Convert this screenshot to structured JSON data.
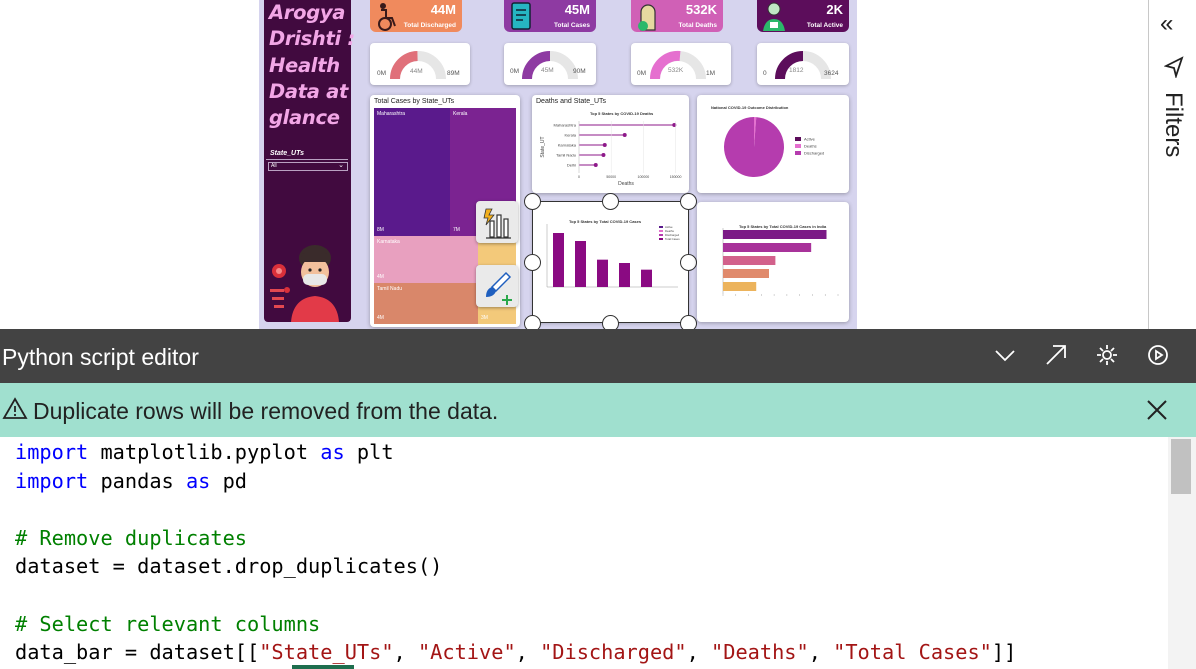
{
  "report": {
    "title_lines": [
      "Arogya",
      "Drishti :",
      "Health",
      "Data at",
      "glance"
    ],
    "slicer": {
      "label": "State_UTs",
      "value": "All"
    },
    "kpis": [
      {
        "value": "44M",
        "label": "Total Discharged",
        "color": "#f08a5d"
      },
      {
        "value": "45M",
        "label": "Total Cases",
        "color": "#8e3aa2"
      },
      {
        "value": "532K",
        "label": "Total Deaths",
        "color": "#d060b6"
      },
      {
        "value": "2K",
        "label": "Total Active",
        "color": "#5c0d5b"
      }
    ],
    "gauges": [
      {
        "min": "0M",
        "value": "44M",
        "max": "89M",
        "fraction": 0.49,
        "color": "#e0707a"
      },
      {
        "min": "0M",
        "value": "45M",
        "max": "90M",
        "fraction": 0.5,
        "color": "#8e3aa2"
      },
      {
        "min": "0M",
        "value": "532K",
        "max": "1M",
        "fraction": 0.53,
        "color": "#e56fcf"
      },
      {
        "min": "0",
        "value": "1812",
        "max": "3624",
        "fraction": 0.5,
        "color": "#5c0d5b"
      }
    ],
    "treemap": {
      "title": "Total Cases by State_UTs",
      "cells": [
        {
          "name": "Maharashtra",
          "value": "8M",
          "color": "#5a1a8c"
        },
        {
          "name": "Kerala",
          "value": "7M",
          "color": "#7b2391"
        },
        {
          "name": "Karnataka",
          "value": "4M",
          "color": "#e8a0bf"
        },
        {
          "name": "Tamil Nadu",
          "value": "4M",
          "color": "#d9876a"
        },
        {
          "name": "",
          "value": "3M",
          "color": "#f3c97a"
        }
      ]
    },
    "deaths_chart": {
      "card_title": "Deaths and State_UTs",
      "chart_title": "Top 5 States by COVID-19 Deaths",
      "ylabel": "State_UT",
      "xlabel": "Deaths",
      "ticks": [
        "0",
        "50000",
        "100000",
        "150000"
      ]
    },
    "pie_chart": {
      "title": "National COVID-19 Outcome Distribution",
      "legend": [
        "Active",
        "Deaths",
        "Discharged"
      ],
      "legend_colors": [
        "#5c0d5b",
        "#e56fcf",
        "#b53cae"
      ]
    },
    "selected_bar": {
      "title": "Top 5 States by Total COVID-19 Cases",
      "legend": [
        "Active",
        "Deaths",
        "Discharged",
        "Total Cases"
      ]
    },
    "hbar_chart": {
      "title": "Top 5 States by Total COVID-19 Cases in India"
    }
  },
  "chart_data": [
    {
      "type": "scatter",
      "title": "Top 5 States by COVID-19 Deaths",
      "xlabel": "Deaths",
      "ylabel": "State_UT",
      "categories": [
        "Maharashtra",
        "Kerala",
        "Karnataka",
        "Tamil Nadu",
        "Delhi"
      ],
      "values": [
        148000,
        71000,
        40000,
        38000,
        26000
      ],
      "xlim": [
        0,
        160000
      ]
    },
    {
      "type": "pie",
      "title": "National COVID-19 Outcome Distribution",
      "categories": [
        "Active",
        "Deaths",
        "Discharged"
      ],
      "values": [
        0.01,
        1.2,
        98.8
      ]
    },
    {
      "type": "bar",
      "title": "Top 5 States by Total COVID-19 Cases",
      "categories": [
        "",
        "",
        "",
        "",
        ""
      ],
      "values": [
        8.1,
        6.9,
        4.1,
        3.6,
        2.6
      ],
      "ylim": [
        0,
        9
      ]
    },
    {
      "type": "bar",
      "title": "Top 5 States by Total COVID-19 Cases in India",
      "categories": [
        "",
        "",
        "",
        "",
        ""
      ],
      "values": [
        8.1,
        6.9,
        4.1,
        3.6,
        2.6
      ],
      "xlim": [
        0,
        9
      ]
    }
  ],
  "pane": {
    "filters_label": "Filters"
  },
  "editor": {
    "title": "Python script editor",
    "warning": "Duplicate rows will be removed from the data.",
    "lines": [
      [
        {
          "t": "import",
          "c": "kw"
        },
        {
          "t": " matplotlib.pyplot ",
          "c": ""
        },
        {
          "t": "as",
          "c": "kw"
        },
        {
          "t": " plt",
          "c": ""
        }
      ],
      [
        {
          "t": "import",
          "c": "kw"
        },
        {
          "t": " pandas ",
          "c": ""
        },
        {
          "t": "as",
          "c": "kw"
        },
        {
          "t": " pd",
          "c": ""
        }
      ],
      [],
      [
        {
          "t": "# Remove duplicates",
          "c": "cm"
        }
      ],
      [
        {
          "t": "dataset = dataset.drop_duplicates()",
          "c": ""
        }
      ],
      [],
      [
        {
          "t": "# Select relevant columns",
          "c": "cm"
        }
      ],
      [
        {
          "t": "data_bar = dataset[[",
          "c": ""
        },
        {
          "t": "\"State_UTs\"",
          "c": "st"
        },
        {
          "t": ", ",
          "c": ""
        },
        {
          "t": "\"Active\"",
          "c": "st"
        },
        {
          "t": ", ",
          "c": ""
        },
        {
          "t": "\"Discharged\"",
          "c": "st"
        },
        {
          "t": ", ",
          "c": ""
        },
        {
          "t": "\"Deaths\"",
          "c": "st"
        },
        {
          "t": ", ",
          "c": ""
        },
        {
          "t": "\"Total Cases\"",
          "c": "st"
        },
        {
          "t": "]]",
          "c": ""
        }
      ]
    ]
  }
}
